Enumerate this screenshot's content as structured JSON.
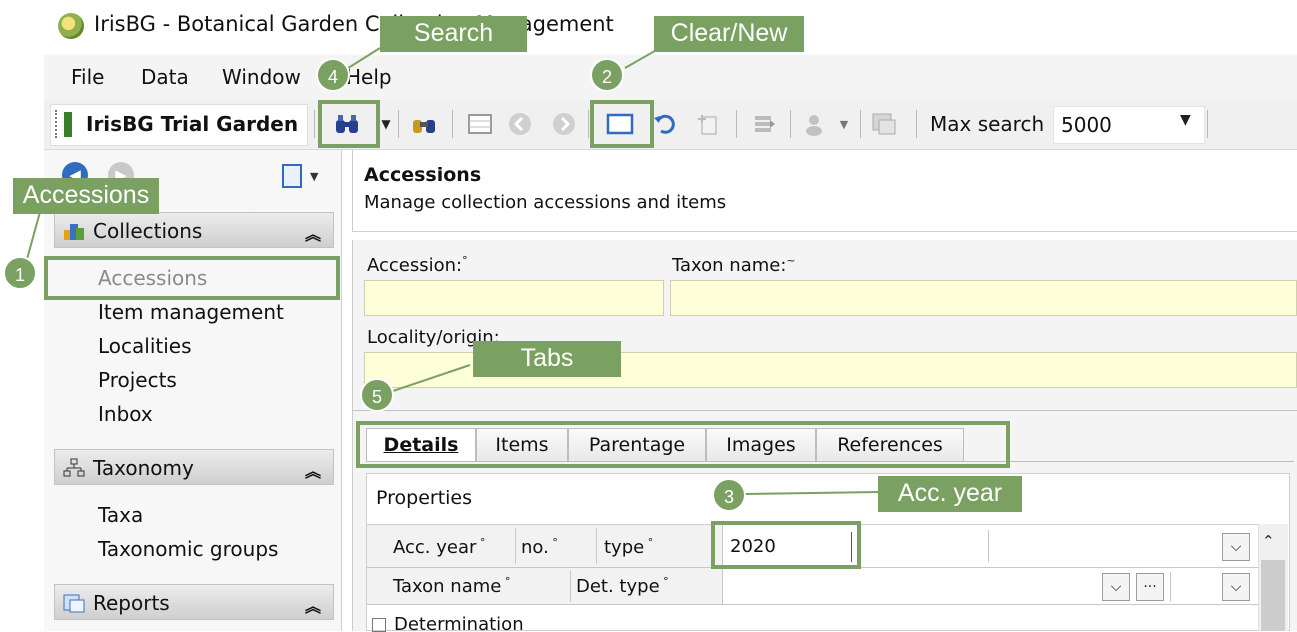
{
  "window": {
    "title": "IrisBG - Botanical Garden Collection Management"
  },
  "menu": {
    "file": "File",
    "data": "Data",
    "window": "Window",
    "help": "Help"
  },
  "toolbar": {
    "garden_name": "IrisBG Trial Garden",
    "max_search_label": "Max search",
    "max_search_value": "5000"
  },
  "sidebar": {
    "groups": [
      {
        "label": "Collections",
        "items": [
          "Accessions",
          "Item management",
          "Localities",
          "Projects",
          "Inbox"
        ]
      },
      {
        "label": "Taxonomy",
        "items": [
          "Taxa",
          "Taxonomic groups"
        ]
      },
      {
        "label": "Reports",
        "items": []
      }
    ]
  },
  "header": {
    "title": "Accessions",
    "subtitle": "Manage collection accessions and items"
  },
  "search_fields": {
    "accession_label": "Accession:",
    "accession_value": "",
    "taxon_label": "Taxon name:",
    "taxon_value": "",
    "locality_label": "Locality/origin:",
    "locality_value": ""
  },
  "tabs": [
    "Details",
    "Items",
    "Parentage",
    "Images",
    "References"
  ],
  "properties": {
    "title": "Properties",
    "acc_year_label": "Acc. year",
    "no_label": "no.",
    "type_label": "type",
    "acc_year_value": "2020",
    "taxon_name_label": "Taxon name",
    "det_type_label": "Det. type",
    "determination_label": "Determination"
  },
  "annotations": {
    "accessions": "Accessions",
    "search": "Search",
    "clear_new": "Clear/New",
    "tabs": "Tabs",
    "acc_year": "Acc. year",
    "n1": "1",
    "n2": "2",
    "n3": "3",
    "n4": "4",
    "n5": "5"
  },
  "colors": {
    "callout": "#7aa161",
    "input_bg": "#fefed8",
    "accent_blue": "#2f6cc0"
  }
}
